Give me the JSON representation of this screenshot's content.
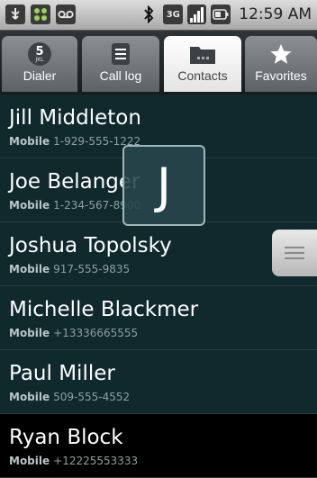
{
  "status_bar": {
    "time": "12:59 AM",
    "network_label": "3G"
  },
  "tabs": [
    {
      "label": "Dialer",
      "icon": "dialer-icon",
      "digit": "5",
      "digit_sub": "JKL"
    },
    {
      "label": "Call log",
      "icon": "call-log-icon"
    },
    {
      "label": "Contacts",
      "icon": "contacts-folder-icon",
      "active": true
    },
    {
      "label": "Favorites",
      "icon": "star-icon"
    }
  ],
  "contacts": [
    {
      "name": "Jill Middleton",
      "type": "Mobile",
      "number": "1-929-555-1222"
    },
    {
      "name": "Joe Belanger",
      "type": "Mobile",
      "number": "1-234-567-8900"
    },
    {
      "name": "Joshua Topolsky",
      "type": "Mobile",
      "number": "917-555-9835"
    },
    {
      "name": "Michelle Blackmer",
      "type": "Mobile",
      "number": "+13336665555"
    },
    {
      "name": "Paul Miller",
      "type": "Mobile",
      "number": "509-555-4552"
    },
    {
      "name": "Ryan Block",
      "type": "Mobile",
      "number": "+12225553333"
    }
  ],
  "fast_scroll": {
    "letter": "J"
  },
  "colors": {
    "list_background": "#10292d",
    "active_tab": "#ffffff",
    "inactive_tab": "#7a7f82"
  }
}
